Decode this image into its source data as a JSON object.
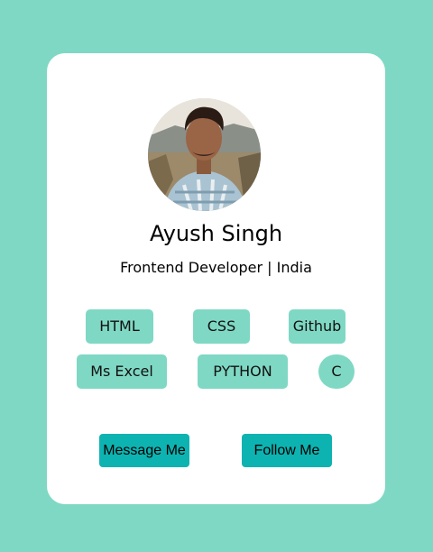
{
  "profile": {
    "name": "Ayush Singh",
    "subtitle": "Frontend Developer | India"
  },
  "skills": [
    "HTML",
    "CSS",
    "Github",
    "Ms Excel",
    "PYTHON",
    "C"
  ],
  "actions": {
    "message_label": "Message Me",
    "follow_label": "Follow Me"
  },
  "colors": {
    "background": "#7fd8c4",
    "card": "#ffffff",
    "skill_chip": "#7fd8c4",
    "button": "#0db3b1"
  }
}
